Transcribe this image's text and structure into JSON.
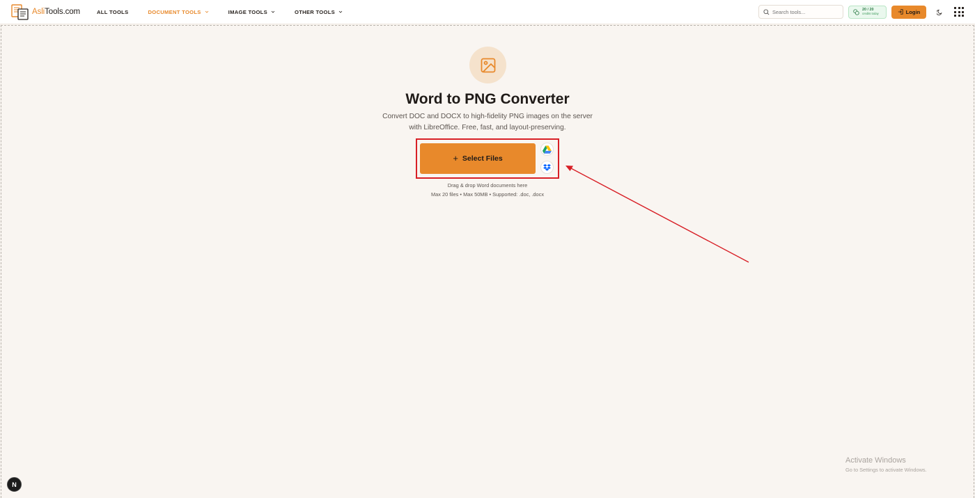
{
  "header": {
    "logo": {
      "prefix": "Asli",
      "suffix": "Tools.com"
    },
    "nav": [
      {
        "label": "ALL TOOLS",
        "has_dropdown": false,
        "active": false
      },
      {
        "label": "DOCUMENT TOOLS",
        "has_dropdown": true,
        "active": true
      },
      {
        "label": "IMAGE TOOLS",
        "has_dropdown": true,
        "active": false
      },
      {
        "label": "OTHER TOOLS",
        "has_dropdown": true,
        "active": false
      }
    ],
    "search": {
      "placeholder": "Search tools..."
    },
    "credits": {
      "count": "20 / 20",
      "label": "credits today"
    },
    "login_label": "Login"
  },
  "main": {
    "title": "Word to PNG Converter",
    "subtitle": "Convert DOC and DOCX to high-fidelity PNG images on the server with LibreOffice. Free, fast, and layout-preserving.",
    "select_button": {
      "icon": "+",
      "label": "Select Files"
    },
    "drag_text": "Drag & drop Word documents here",
    "limits_text": "Max 20 files • Max 50MB • Supported: .doc, .docx",
    "cloud_sources": [
      "google-drive-icon",
      "dropbox-icon"
    ]
  },
  "watermark": {
    "title": "Activate Windows",
    "subtitle": "Go to Settings to activate Windows."
  },
  "badge": {
    "letter": "N"
  },
  "colors": {
    "accent": "#e8892b",
    "background": "#f9f5f1",
    "highlight": "#d81f26",
    "credits_green": "#2e7d48"
  }
}
